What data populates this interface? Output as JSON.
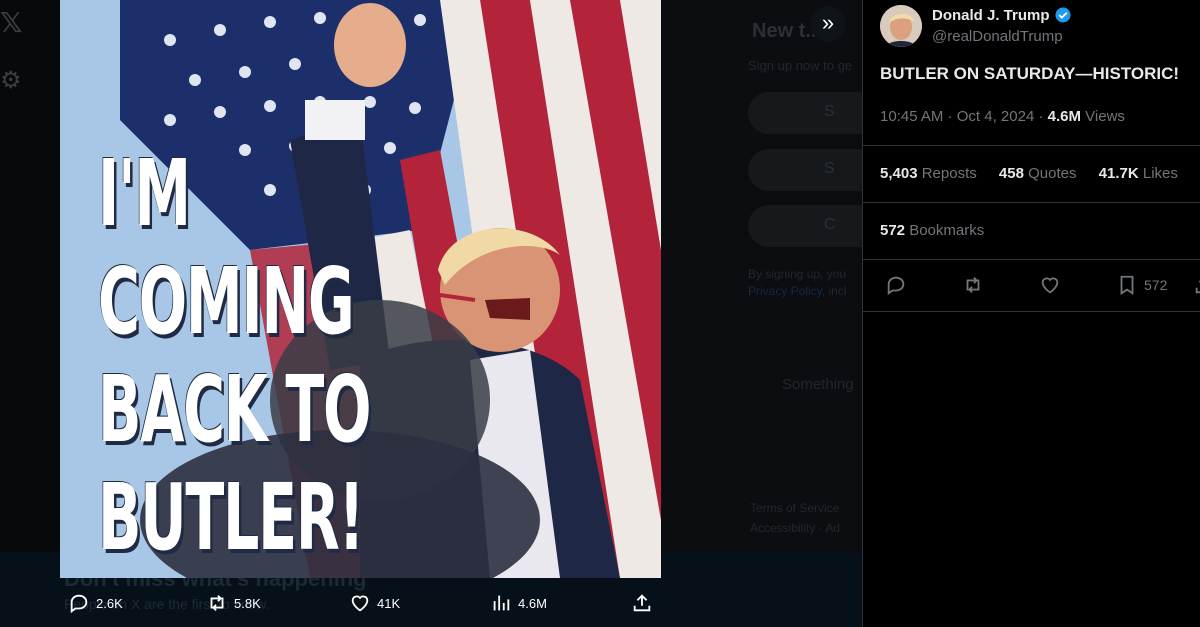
{
  "background": {
    "new_title": "New t...?",
    "signup_sub": "Sign up now to ge",
    "pill_google": "S",
    "pill_apple": "S",
    "pill_create": "C",
    "legal_line1": "By signing up, you",
    "legal_link": "Privacy Policy",
    "legal_rest": ", incl",
    "something": "Something",
    "terms_line1": "Terms of Service",
    "terms_line2": "Accessibility · Ad",
    "banner_title": "Don't miss what's happening",
    "banner_sub": "People on X are the first to know."
  },
  "media": {
    "headline_lines": [
      "I'M",
      "COMING",
      "BACK TO",
      "BUTLER!"
    ]
  },
  "media_actions": {
    "replies": "2.6K",
    "reposts": "5.8K",
    "likes": "41K",
    "views": "4.6M"
  },
  "tweet": {
    "author_name": "Donald J. Trump",
    "handle": "@realDonaldTrump",
    "text": "BUTLER ON SATURDAY—HISTORIC!",
    "time": "10:45 AM",
    "date": "Oct 4, 2024",
    "views_count": "4.6M",
    "views_label": " Views",
    "reposts_count": "5,403",
    "reposts_label": " Reposts",
    "quotes_count": "458",
    "quotes_label": " Quotes",
    "likes_count": "41.7K",
    "likes_label": " Likes",
    "bookmarks_count": "572",
    "bookmarks_label": " Bookmarks",
    "bookmark_action_count": "572"
  },
  "colors": {
    "verified": "#1d9bf0",
    "text_primary": "#e7e9ea",
    "text_secondary": "#71767b",
    "border": "#2f3336"
  },
  "icons": [
    "x-logo-icon",
    "gear-icon",
    "expand-icon",
    "reply-icon",
    "repost-icon",
    "like-icon",
    "views-icon",
    "share-icon",
    "bookmark-icon",
    "verified-badge-icon"
  ]
}
